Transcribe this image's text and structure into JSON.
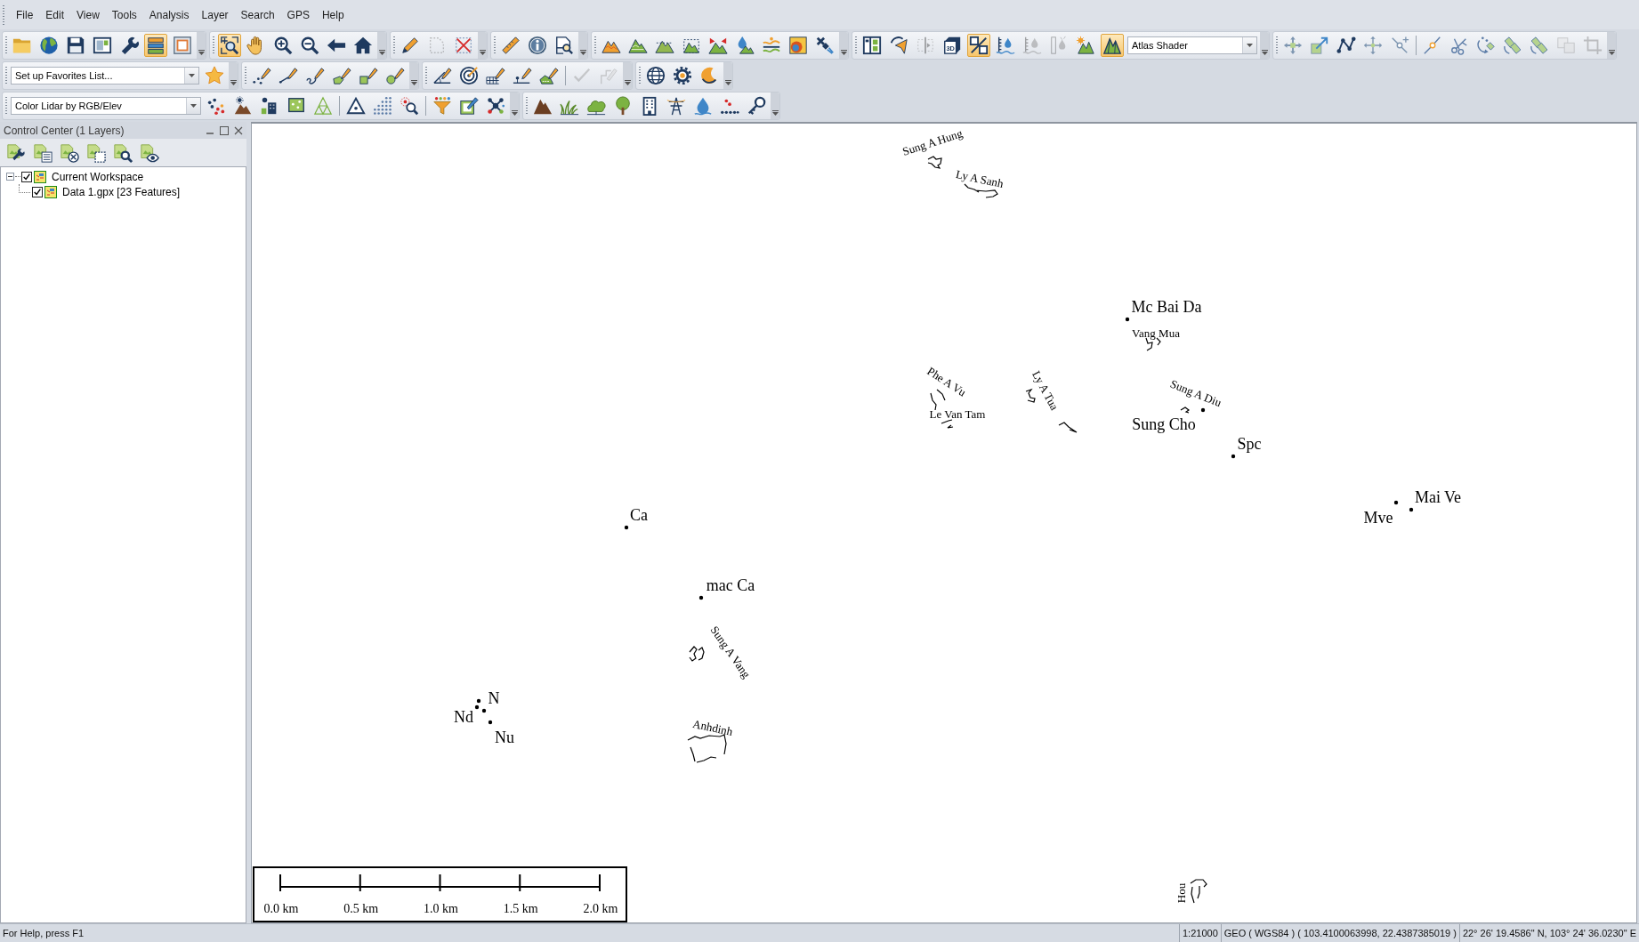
{
  "menu": [
    "File",
    "Edit",
    "View",
    "Tools",
    "Analysis",
    "Layer",
    "Search",
    "GPS",
    "Help"
  ],
  "toolbars": [
    {
      "groups": [
        {
          "items": [
            {
              "kind": "button",
              "on": false,
              "disabled": false
            },
            {
              "kind": "button",
              "on": false,
              "disabled": false
            },
            {
              "kind": "button",
              "on": false,
              "disabled": false
            },
            {
              "kind": "button",
              "on": false,
              "disabled": false
            },
            {
              "kind": "button",
              "on": false,
              "disabled": false
            },
            {
              "kind": "button",
              "on": true,
              "disabled": false
            },
            {
              "kind": "button",
              "on": false,
              "disabled": false
            }
          ]
        },
        {
          "items": [
            {
              "kind": "button",
              "on": true,
              "disabled": false
            },
            {
              "kind": "button",
              "on": false,
              "disabled": false
            },
            {
              "kind": "button",
              "on": false,
              "disabled": false
            },
            {
              "kind": "button",
              "on": false,
              "disabled": false
            },
            {
              "kind": "button",
              "on": false,
              "disabled": false
            },
            {
              "kind": "button",
              "on": false,
              "disabled": false
            }
          ]
        },
        {
          "items": [
            {
              "kind": "button",
              "on": false,
              "disabled": false
            },
            {
              "kind": "button",
              "on": false,
              "disabled": true
            },
            {
              "kind": "button",
              "on": false,
              "disabled": false
            }
          ]
        },
        {
          "items": [
            {
              "kind": "button",
              "on": false,
              "disabled": false
            },
            {
              "kind": "button",
              "on": false,
              "disabled": false
            },
            {
              "kind": "button",
              "on": false,
              "disabled": false
            }
          ]
        },
        {
          "items": [
            {
              "kind": "button",
              "on": false,
              "disabled": false
            },
            {
              "kind": "button",
              "on": false,
              "disabled": false
            },
            {
              "kind": "button",
              "on": false,
              "disabled": false
            },
            {
              "kind": "button",
              "on": false,
              "disabled": false
            },
            {
              "kind": "button",
              "on": false,
              "disabled": false
            },
            {
              "kind": "button",
              "on": false,
              "disabled": false
            },
            {
              "kind": "button",
              "on": false,
              "disabled": false
            },
            {
              "kind": "button",
              "on": false,
              "disabled": false
            },
            {
              "kind": "button",
              "on": false,
              "disabled": false
            }
          ]
        },
        {
          "items": [
            {
              "kind": "button",
              "on": false,
              "disabled": false
            },
            {
              "kind": "button",
              "on": false,
              "disabled": false
            },
            {
              "kind": "button",
              "on": false,
              "disabled": true
            },
            {
              "kind": "button",
              "on": false,
              "disabled": false,
              "text": "3D"
            },
            {
              "kind": "button",
              "on": true,
              "disabled": false
            },
            {
              "kind": "button",
              "on": false,
              "disabled": false
            },
            {
              "kind": "button",
              "on": false,
              "disabled": true
            },
            {
              "kind": "button",
              "on": false,
              "disabled": true
            },
            {
              "kind": "button",
              "on": false,
              "disabled": false
            },
            {
              "kind": "button",
              "on": true,
              "disabled": false
            },
            {
              "kind": "combo",
              "value": "Atlas Shader"
            }
          ]
        },
        {
          "items": [
            {
              "kind": "button",
              "on": false,
              "disabled": false
            },
            {
              "kind": "button",
              "on": false,
              "disabled": false
            },
            {
              "kind": "button",
              "on": false,
              "disabled": false
            },
            {
              "kind": "button",
              "on": false,
              "disabled": false
            },
            {
              "kind": "button",
              "on": false,
              "disabled": false
            },
            {
              "kind": "button",
              "on": false,
              "disabled": false
            },
            {
              "kind": "button",
              "on": false,
              "disabled": false
            },
            {
              "kind": "button",
              "on": false,
              "disabled": false
            },
            {
              "kind": "button",
              "on": false,
              "disabled": false
            },
            {
              "kind": "button",
              "on": false,
              "disabled": false
            },
            {
              "kind": "button",
              "on": false,
              "disabled": true
            },
            {
              "kind": "button",
              "on": false,
              "disabled": true
            }
          ]
        }
      ]
    },
    {
      "groups": [
        {
          "items": [
            {
              "kind": "combo",
              "value": "Set up Favorites List..."
            },
            {
              "kind": "button",
              "on": false,
              "disabled": false
            }
          ]
        },
        {
          "items": [
            {
              "kind": "button",
              "on": false,
              "disabled": false
            },
            {
              "kind": "button",
              "on": false,
              "disabled": false
            },
            {
              "kind": "button",
              "on": false,
              "disabled": false
            },
            {
              "kind": "button",
              "on": false,
              "disabled": false
            },
            {
              "kind": "button",
              "on": false,
              "disabled": false
            },
            {
              "kind": "button",
              "on": false,
              "disabled": false
            }
          ]
        },
        {
          "items": [
            {
              "kind": "button",
              "on": false,
              "disabled": false
            },
            {
              "kind": "button",
              "on": false,
              "disabled": false
            },
            {
              "kind": "button",
              "on": false,
              "disabled": false
            },
            {
              "kind": "button",
              "on": false,
              "disabled": false
            },
            {
              "kind": "button",
              "on": false,
              "disabled": false
            },
            {
              "kind": "button",
              "on": false,
              "disabled": true
            },
            {
              "kind": "button",
              "on": false,
              "disabled": true
            }
          ]
        },
        {
          "items": [
            {
              "kind": "button",
              "on": false,
              "disabled": false
            },
            {
              "kind": "button",
              "on": false,
              "disabled": false
            },
            {
              "kind": "button",
              "on": false,
              "disabled": false
            }
          ]
        }
      ]
    },
    {
      "groups": [
        {
          "items": [
            {
              "kind": "combo",
              "value": "Color Lidar by RGB/Elev"
            },
            {
              "kind": "button",
              "on": false,
              "disabled": false
            },
            {
              "kind": "button",
              "on": false,
              "disabled": false
            },
            {
              "kind": "button",
              "on": false,
              "disabled": false
            },
            {
              "kind": "button",
              "on": false,
              "disabled": false
            },
            {
              "kind": "button",
              "on": false,
              "disabled": false
            },
            {
              "kind": "button",
              "on": false,
              "disabled": false
            },
            {
              "kind": "button",
              "on": false,
              "disabled": false
            },
            {
              "kind": "button",
              "on": false,
              "disabled": false
            },
            {
              "kind": "button",
              "on": false,
              "disabled": false
            },
            {
              "kind": "button",
              "on": false,
              "disabled": false
            },
            {
              "kind": "button",
              "on": false,
              "disabled": false
            }
          ]
        },
        {
          "items": [
            {
              "kind": "button",
              "on": false,
              "disabled": false
            },
            {
              "kind": "button",
              "on": false,
              "disabled": false
            },
            {
              "kind": "button",
              "on": false,
              "disabled": false
            },
            {
              "kind": "button",
              "on": false,
              "disabled": false
            },
            {
              "kind": "button",
              "on": false,
              "disabled": false
            },
            {
              "kind": "button",
              "on": false,
              "disabled": false
            },
            {
              "kind": "button",
              "on": false,
              "disabled": false
            },
            {
              "kind": "button",
              "on": false,
              "disabled": false
            },
            {
              "kind": "button",
              "on": false,
              "disabled": false
            }
          ]
        }
      ]
    }
  ],
  "control_center": {
    "title": "Control Center (1 Layers)",
    "tree": [
      {
        "label": "Current Workspace",
        "checked": true,
        "expanded": true,
        "children": [
          {
            "label": "Data 1.gpx [23 Features]",
            "checked": true
          }
        ]
      }
    ]
  },
  "map": {
    "features": [
      {
        "kind": "track",
        "label": "Sung A Hung"
      },
      {
        "kind": "track",
        "label": "Ly A Sanh"
      },
      {
        "kind": "waypoint",
        "label": "Mc Bai Da"
      },
      {
        "kind": "track",
        "label": "Vang Mua"
      },
      {
        "kind": "track",
        "label": "Phe A Vu"
      },
      {
        "kind": "track",
        "label": "Ly A Tua"
      },
      {
        "kind": "track",
        "label": "Sung A Diu"
      },
      {
        "kind": "track",
        "label": "Le Van Tam"
      },
      {
        "kind": "waypoint",
        "label": "Sung Cho"
      },
      {
        "kind": "track"
      },
      {
        "kind": "waypoint",
        "label": "Spc"
      },
      {
        "kind": "waypoint",
        "label": "Mai Ve"
      },
      {
        "kind": "waypoint",
        "label": "Ca"
      },
      {
        "kind": "waypoint",
        "label": "Mve"
      },
      {
        "kind": "waypoint",
        "label": "mac Ca"
      },
      {
        "kind": "track",
        "label": "Sung A Vang"
      },
      {
        "kind": "waypoint",
        "label": "N"
      },
      {
        "kind": "waypoint"
      },
      {
        "kind": "waypoint",
        "label": "Nd"
      },
      {
        "kind": "waypoint",
        "label": "Nu"
      },
      {
        "kind": "track",
        "label": "Anhdinh"
      },
      {
        "kind": "track",
        "label": "Hou"
      }
    ],
    "scale_bar": {
      "labels": [
        "0.0 km",
        "0.5 km",
        "1.0 km",
        "1.5 km",
        "2.0 km"
      ]
    }
  },
  "status_bar": [
    "For Help, press F1",
    "1:21000",
    "GEO ( WGS84 ) ( 103.4100063998, 22.4387385019 )",
    "22° 26' 19.4586\" N, 103° 24' 36.0230\" E"
  ]
}
